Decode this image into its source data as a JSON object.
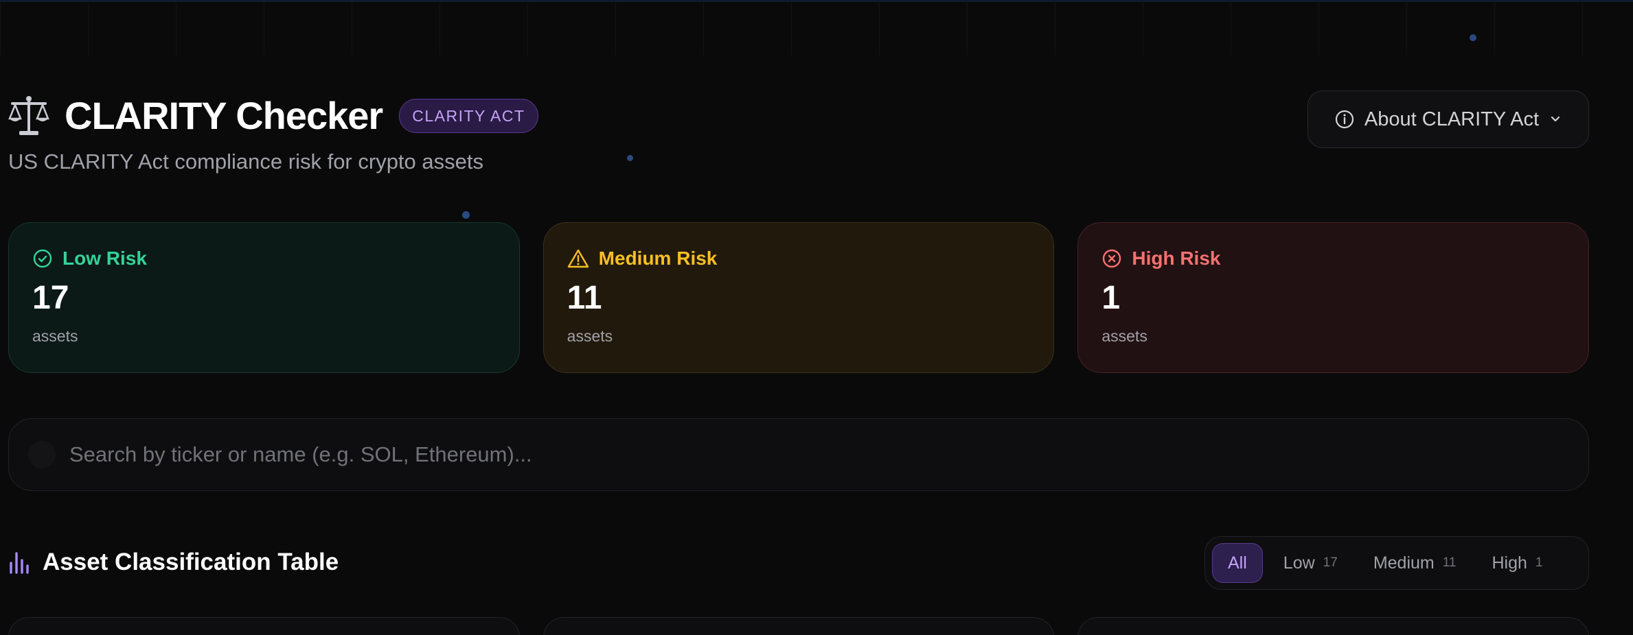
{
  "header": {
    "title": "CLARITY Checker",
    "badge": "CLARITY ACT",
    "subtitle": "US CLARITY Act compliance risk for crypto assets",
    "about_label": "About CLARITY Act",
    "title_icon": "scale-icon"
  },
  "stats": {
    "low": {
      "label": "Low Risk",
      "count": "17",
      "unit": "assets",
      "icon": "check-circle-icon",
      "color": "#34d399"
    },
    "medium": {
      "label": "Medium Risk",
      "count": "11",
      "unit": "assets",
      "icon": "warning-triangle-icon",
      "color": "#fbbf24"
    },
    "high": {
      "label": "High Risk",
      "count": "1",
      "unit": "assets",
      "icon": "x-circle-icon",
      "color": "#f87171"
    }
  },
  "search": {
    "placeholder": "Search by ticker or name (e.g. SOL, Ethereum)...",
    "value": ""
  },
  "table": {
    "title": "Asset Classification Table",
    "title_icon": "bar-chart-icon",
    "filters": [
      {
        "label": "All",
        "count": "",
        "active": true
      },
      {
        "label": "Low",
        "count": "17"
      },
      {
        "label": "Medium",
        "count": "11"
      },
      {
        "label": "High",
        "count": "1"
      }
    ]
  },
  "colors": {
    "accent": "#a78bfa",
    "background": "#0a0a0b"
  }
}
